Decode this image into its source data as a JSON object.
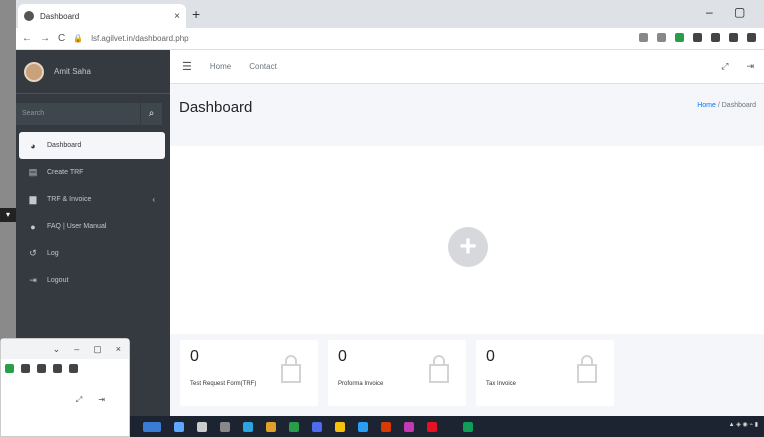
{
  "browser": {
    "tab_title": "Dashboard",
    "url": "lsf.agilvet.in/dashboard.php"
  },
  "sidebar": {
    "user_name": "Amit Saha",
    "search_placeholder": "Search",
    "items": [
      {
        "label": "Dashboard",
        "icon": "tachometer-icon",
        "active": true
      },
      {
        "label": "Create TRF",
        "icon": "form-icon"
      },
      {
        "label": "TRF & Invoice",
        "icon": "document-icon"
      },
      {
        "label": "FAQ | User Manual",
        "icon": "question-icon"
      },
      {
        "label": "Log",
        "icon": "history-icon"
      },
      {
        "label": "Logout",
        "icon": "logout-icon"
      }
    ]
  },
  "topnav": {
    "links": [
      "Home",
      "Contact"
    ]
  },
  "page": {
    "title": "Dashboard",
    "breadcrumb_home": "Home",
    "breadcrumb_sep": " / ",
    "breadcrumb_current": "Dashboard"
  },
  "stats": [
    {
      "value": "0",
      "label": "Test Request Form(TRF)"
    },
    {
      "value": "0",
      "label": "Proforma Invoice"
    },
    {
      "value": "0",
      "label": "Tax Invoice"
    }
  ],
  "colors": {
    "sidebar": "#343a40",
    "active_bg": "#f4f6f9",
    "link": "#007bff"
  }
}
